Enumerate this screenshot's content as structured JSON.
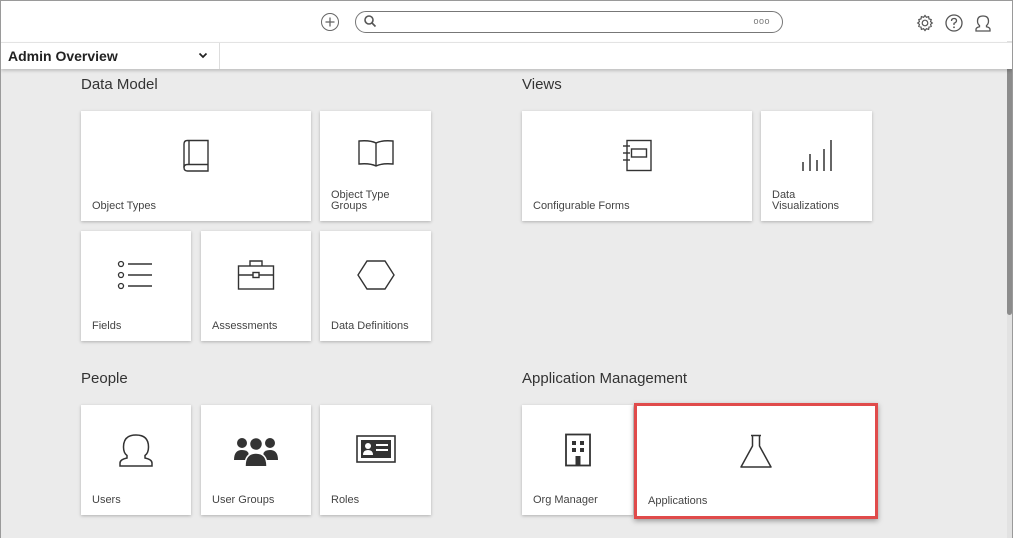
{
  "topbar": {
    "add_icon": "plus-circle-icon",
    "search_icon": "search-icon",
    "search_more_label": "ooo",
    "settings_icon": "gear-icon",
    "help_icon": "help-icon",
    "profile_icon": "user-icon"
  },
  "subbar": {
    "dashboard_label": "Admin Overview",
    "chevron_icon": "chevron-down-icon"
  },
  "sections": {
    "data_model": {
      "title": "Data Model",
      "tiles": {
        "object_types": "Object Types",
        "object_type_groups": "Object Type Groups",
        "fields": "Fields",
        "assessments": "Assessments",
        "data_definitions": "Data Definitions"
      }
    },
    "views": {
      "title": "Views",
      "tiles": {
        "configurable_forms": "Configurable Forms",
        "data_visualizations": "Data Visualizations"
      }
    },
    "people": {
      "title": "People",
      "tiles": {
        "users": "Users",
        "user_groups": "User Groups",
        "roles": "Roles"
      }
    },
    "application_management": {
      "title": "Application Management",
      "tiles": {
        "org_manager": "Org Manager",
        "applications": "Applications"
      }
    }
  },
  "colors": {
    "highlight_border": "#e04b4b",
    "background": "#ebebeb",
    "icon_stroke": "#333333"
  }
}
